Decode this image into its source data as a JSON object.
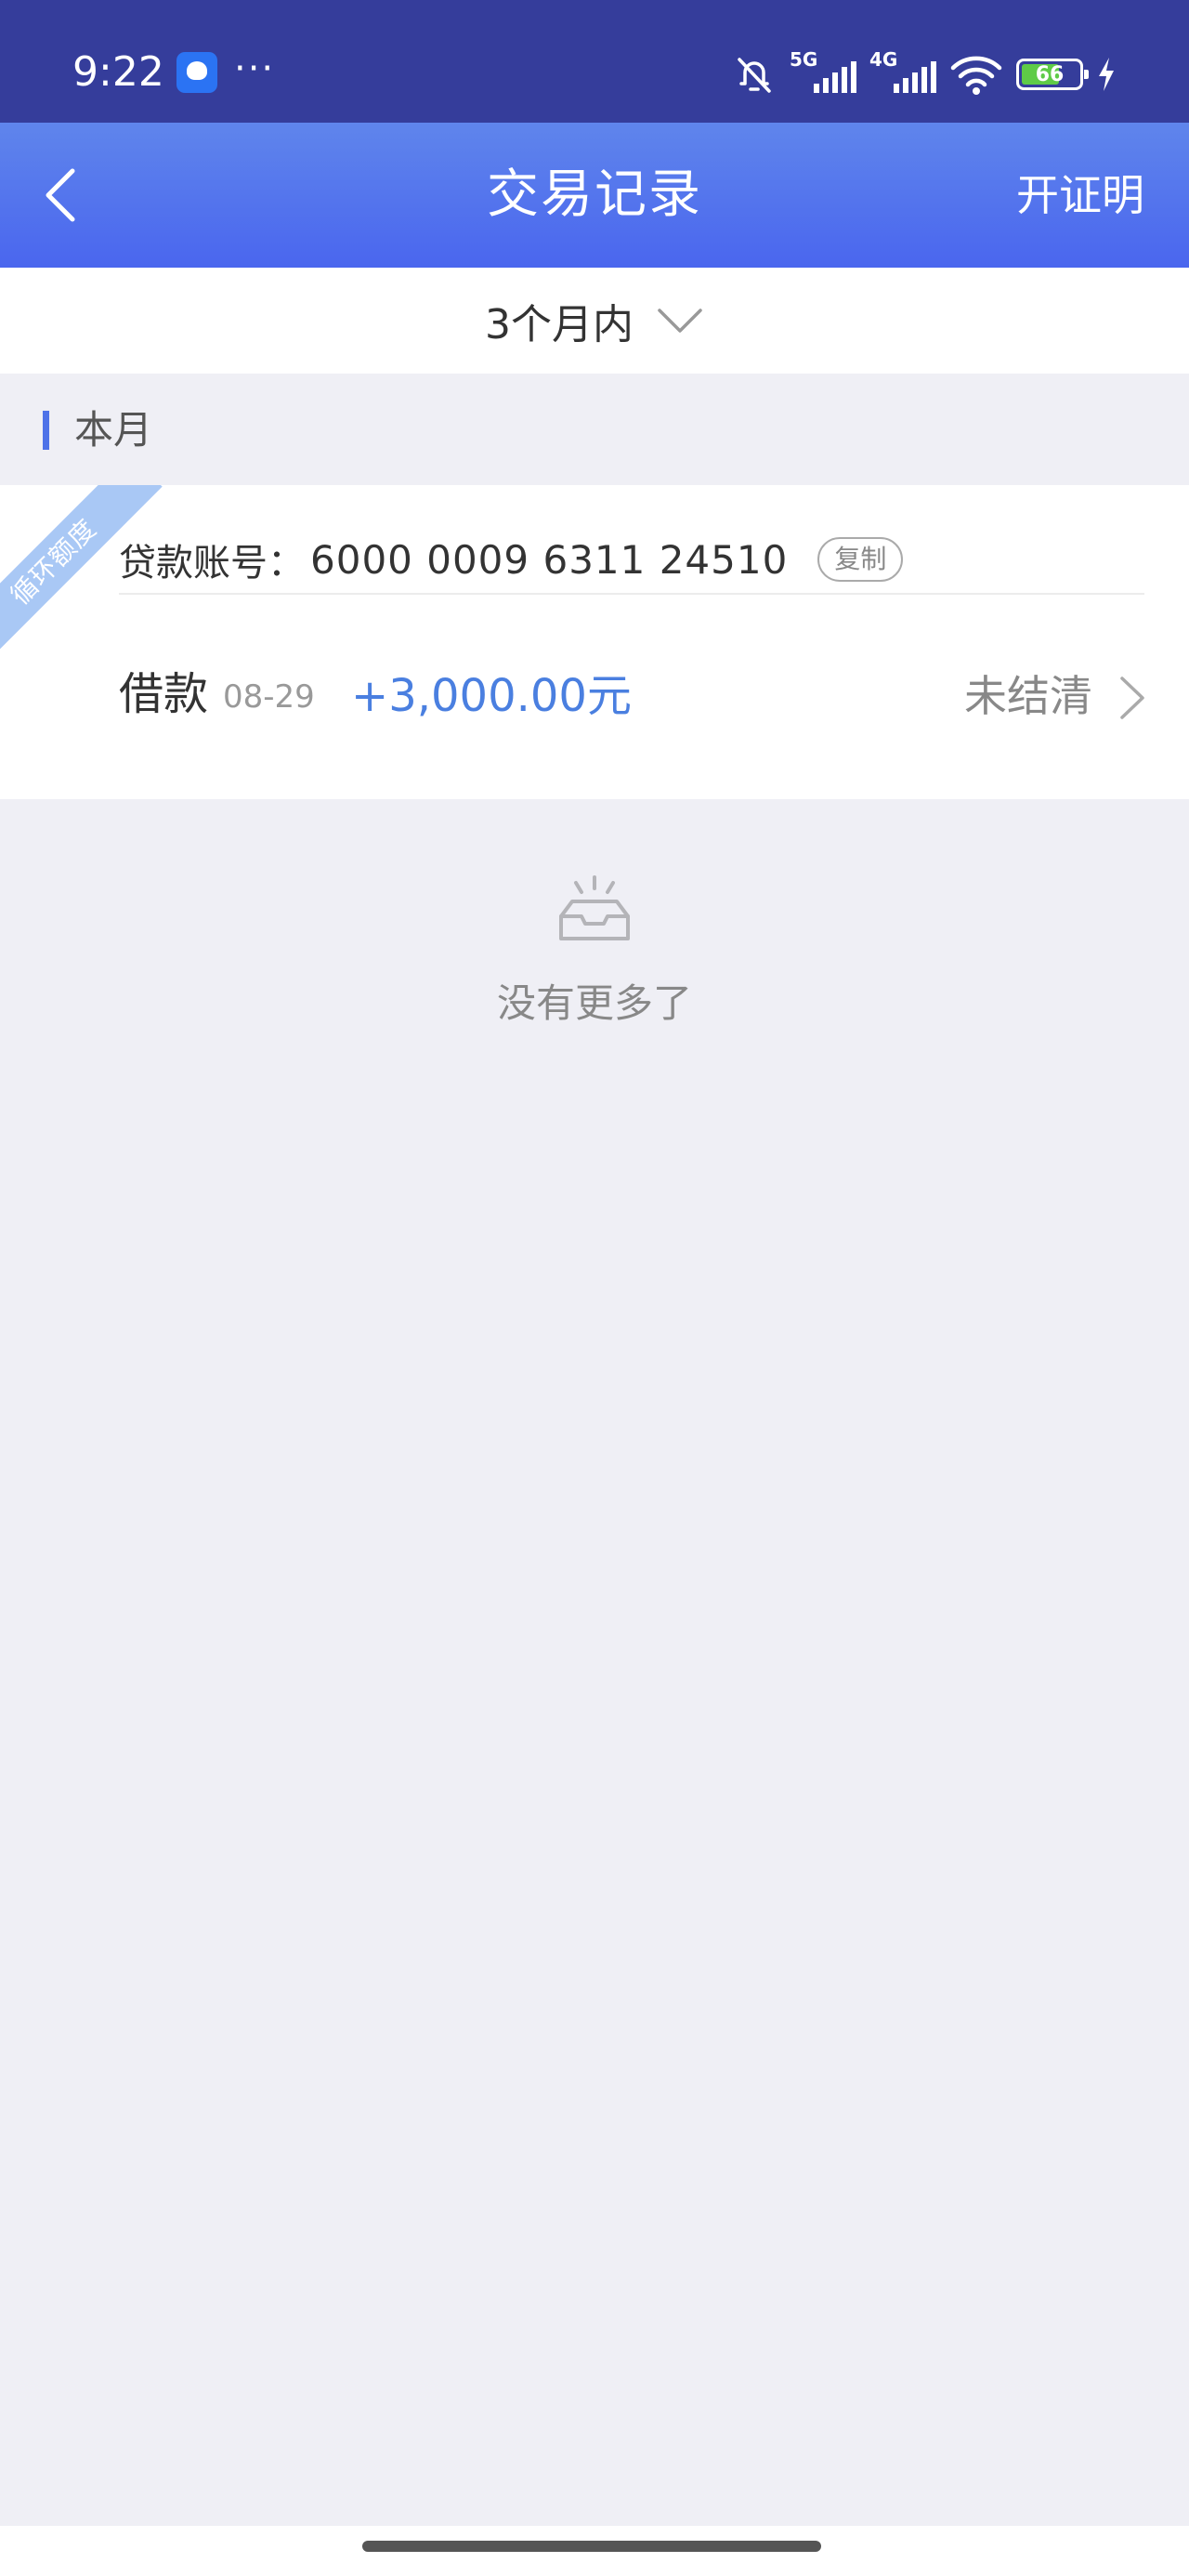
{
  "status_bar": {
    "time": "9:22",
    "dots": "···",
    "sig1_tag": "5G",
    "sig2_tag": "4G",
    "battery": "66"
  },
  "nav": {
    "title": "交易记录",
    "action": "开证明"
  },
  "filter": {
    "label": "3个月内"
  },
  "month": {
    "label": "本月"
  },
  "card": {
    "ribbon": "循环额度",
    "account_label": "贷款账号：",
    "account_number": "6000 0009 6311 24510",
    "copy_label": "复制",
    "transaction": {
      "type": "借款",
      "date": "08-29",
      "amount": "+3,000.00元",
      "status": "未结清"
    }
  },
  "empty": {
    "text": "没有更多了"
  },
  "colors": {
    "status_bar": "#353d9b",
    "nav_gradient_top": "#5f85ec",
    "nav_gradient_bottom": "#4a66ee",
    "accent_amount": "#4a7fe0",
    "ribbon": "#a9c8f5",
    "background": "#efeff5"
  }
}
